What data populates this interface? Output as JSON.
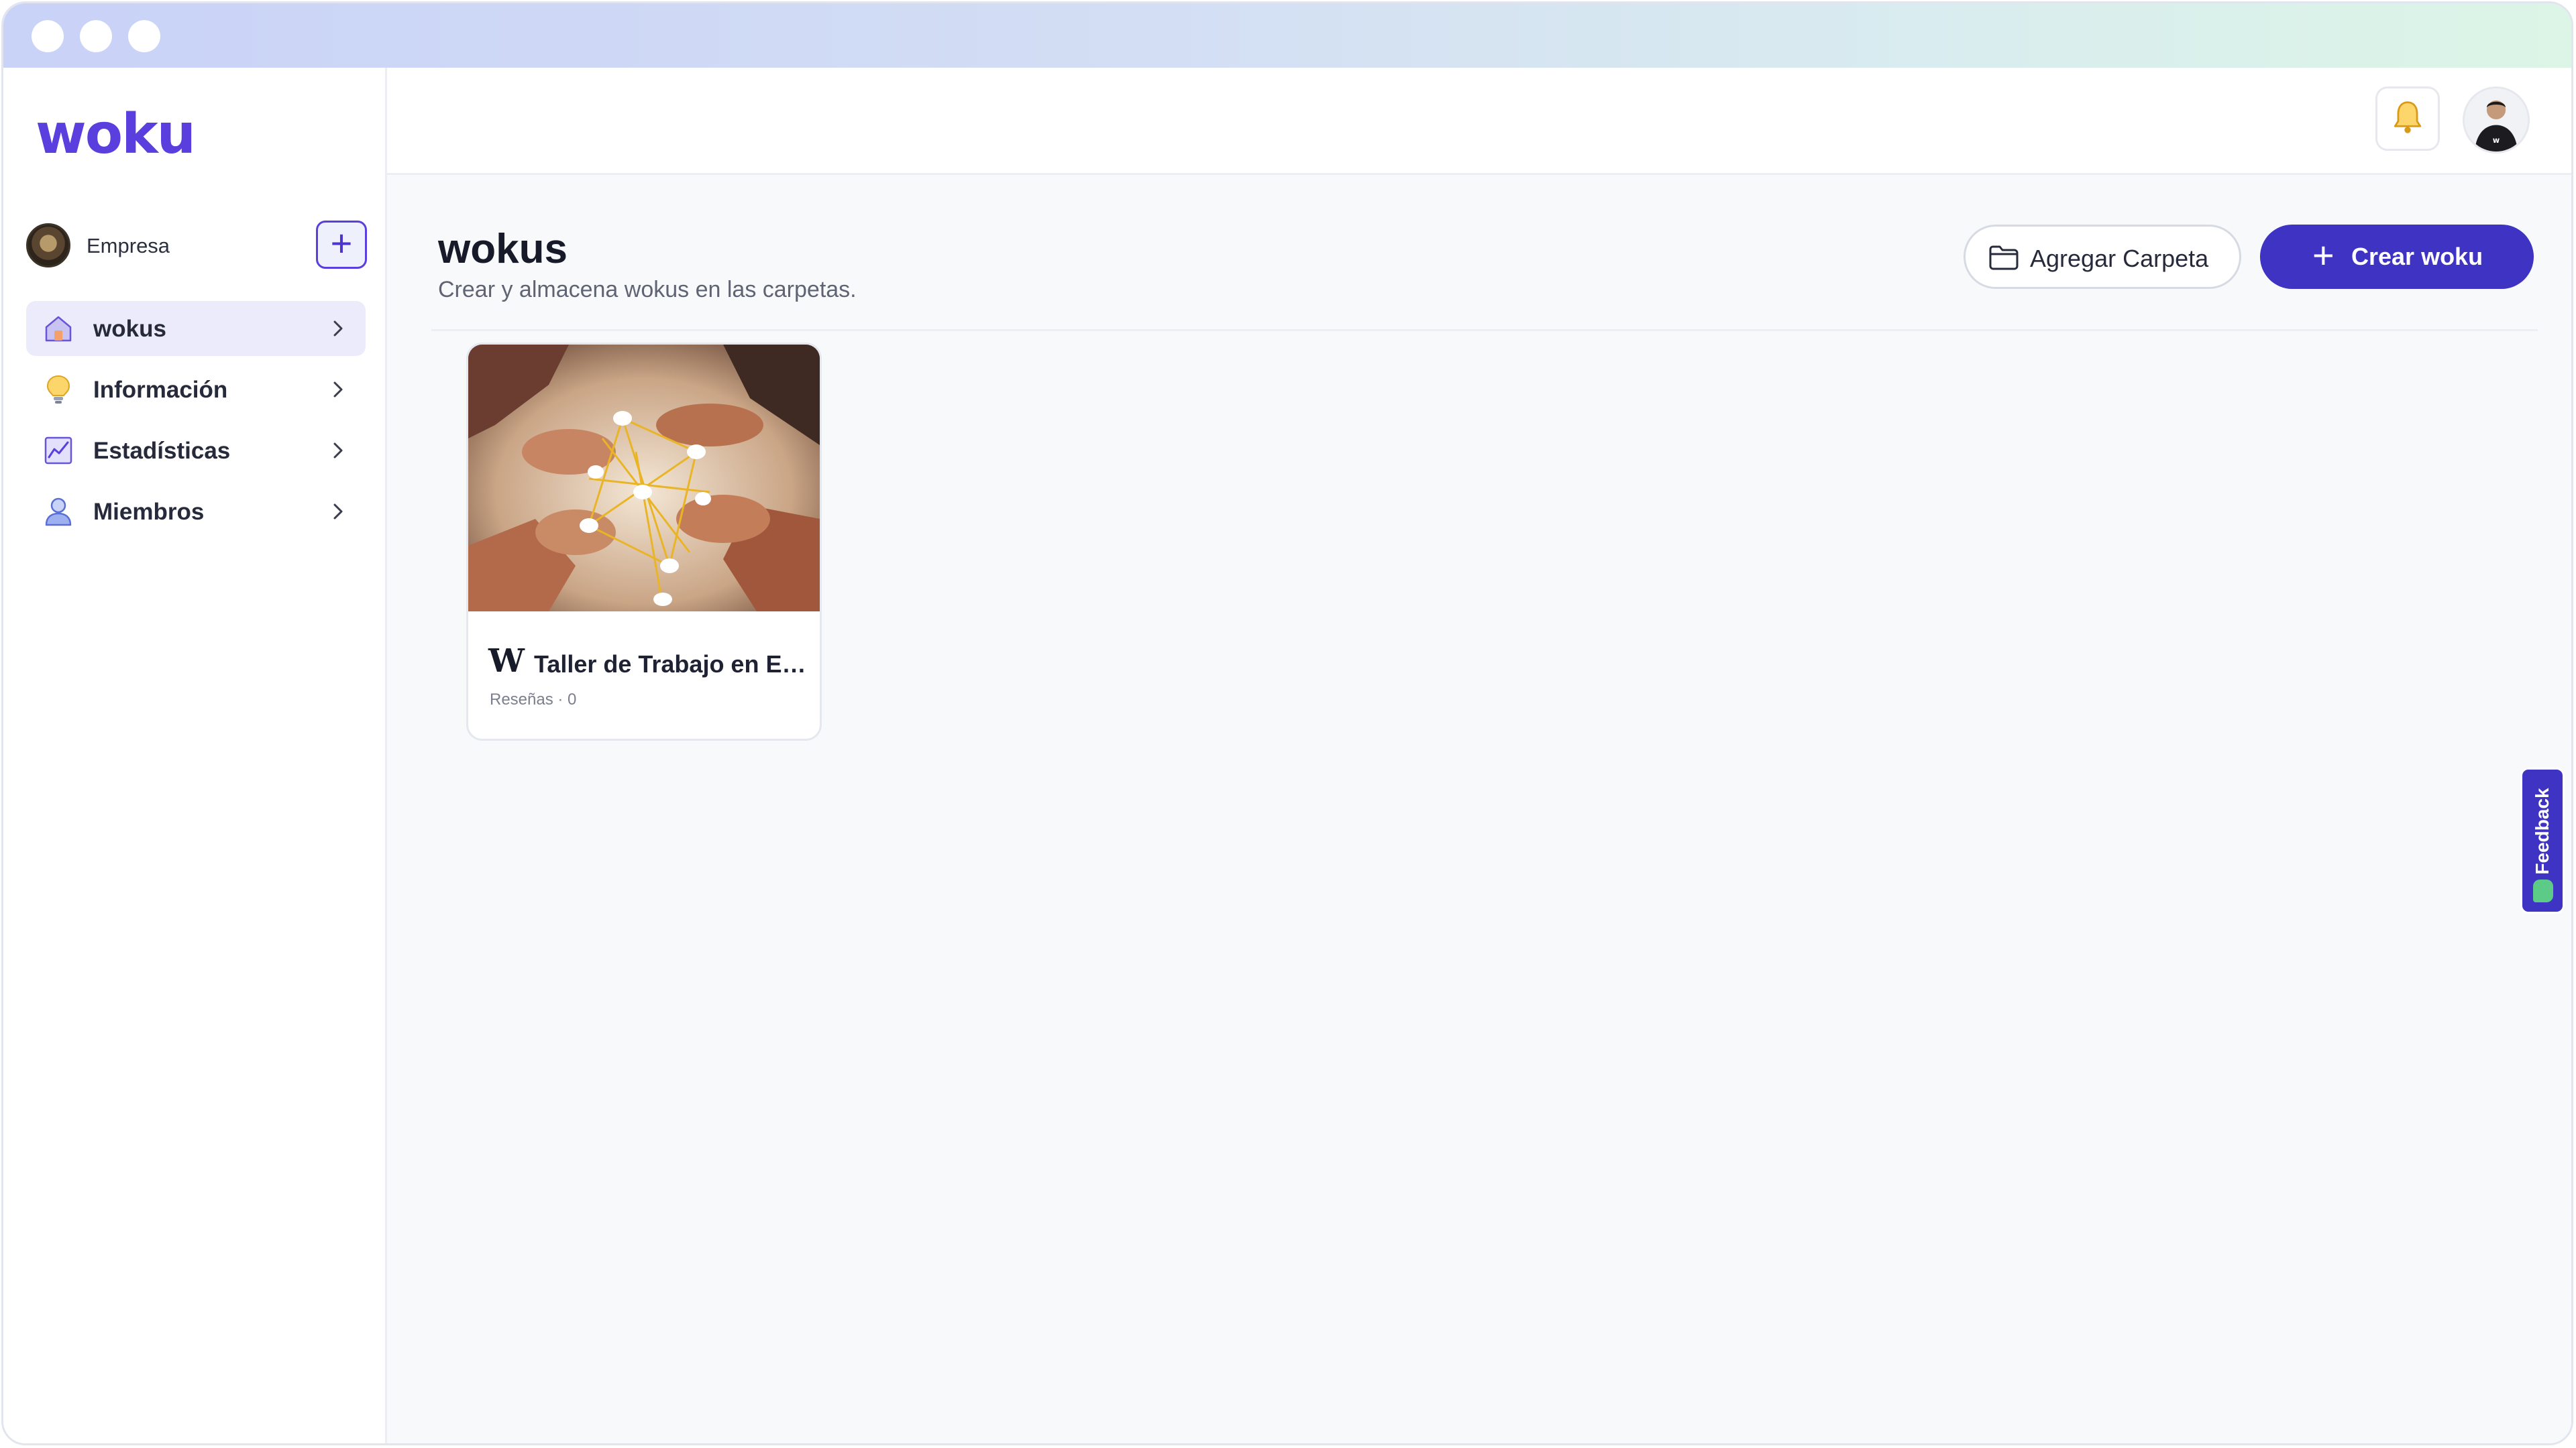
{
  "app": {
    "logo": "woku"
  },
  "sidebar": {
    "company": {
      "name": "Empresa",
      "add_label": "+"
    },
    "items": [
      {
        "label": "wokus",
        "icon": "home-icon",
        "active": true
      },
      {
        "label": "Información",
        "icon": "lightbulb-icon",
        "active": false
      },
      {
        "label": "Estadísticas",
        "icon": "chart-icon",
        "active": false
      },
      {
        "label": "Miembros",
        "icon": "user-icon",
        "active": false
      }
    ]
  },
  "header": {
    "bell_icon": "bell-icon",
    "avatar": "user-avatar"
  },
  "main": {
    "title": "wokus",
    "subtitle": "Crear y almacena wokus en las carpetas.",
    "add_folder_label": "Agregar Carpeta",
    "create_label": "Crear woku",
    "create_plus": "+"
  },
  "cards": [
    {
      "logo": "W",
      "title": "Taller de Trabajo en Eq...",
      "meta": "Reseñas · 0"
    }
  ],
  "feedback": {
    "label": "Feedback"
  },
  "colors": {
    "accent": "#3f33c4",
    "logo": "#5b3fde",
    "active_bg": "#ecebfc"
  }
}
